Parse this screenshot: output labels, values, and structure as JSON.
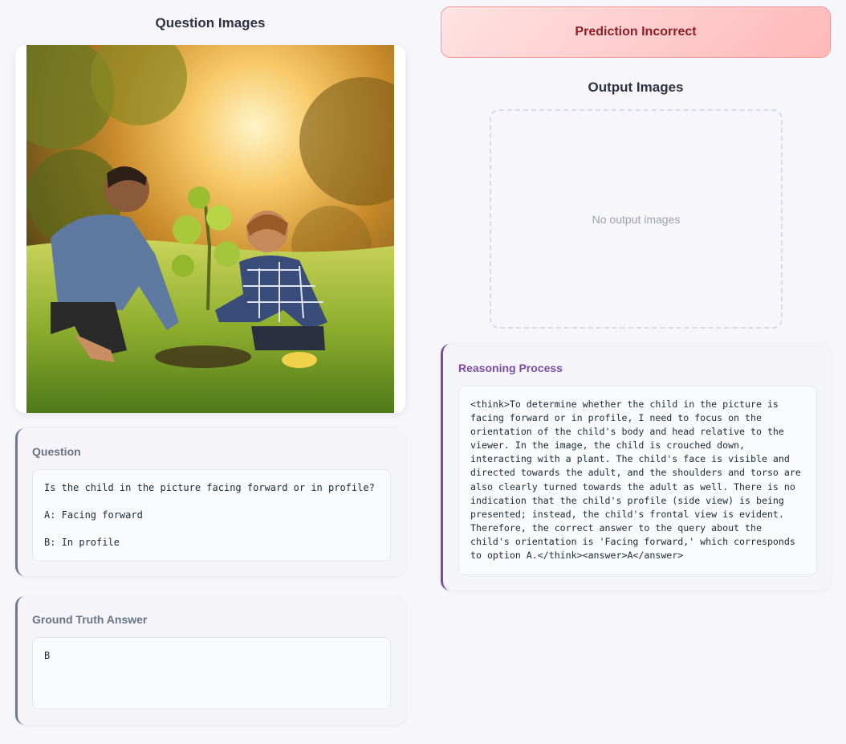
{
  "left": {
    "question_images_title": "Question Images",
    "question": {
      "label": "Question",
      "lines": [
        "Is the child in the picture facing forward or in profile?",
        "A: Facing forward",
        "B: In profile"
      ]
    },
    "ground_truth": {
      "label": "Ground Truth Answer",
      "value": "B"
    }
  },
  "right": {
    "prediction_status": "Prediction Incorrect",
    "output_images_title": "Output Images",
    "no_output_text": "No output images",
    "reasoning": {
      "label": "Reasoning Process",
      "text": "<think>To determine whether the child in the picture is facing forward or in profile, I need to focus on the orientation of the child's body and head relative to the viewer. In the image, the child is crouched down, interacting with a plant. The child's face is visible and directed towards the adult, and the shoulders and torso are also clearly turned towards the adult as well. There is no indication that the child's profile (side view) is being presented; instead, the child's frontal view is evident. Therefore, the correct answer to the query about the child's orientation is 'Facing forward,' which corresponds to option A.</think><answer>A</answer>"
    }
  },
  "colors": {
    "incorrect_banner": "#ffb8b8",
    "incorrect_text": "#8b1f2a",
    "reasoning_accent": "#7b4ca6",
    "card_accent": "#6b7a99"
  }
}
